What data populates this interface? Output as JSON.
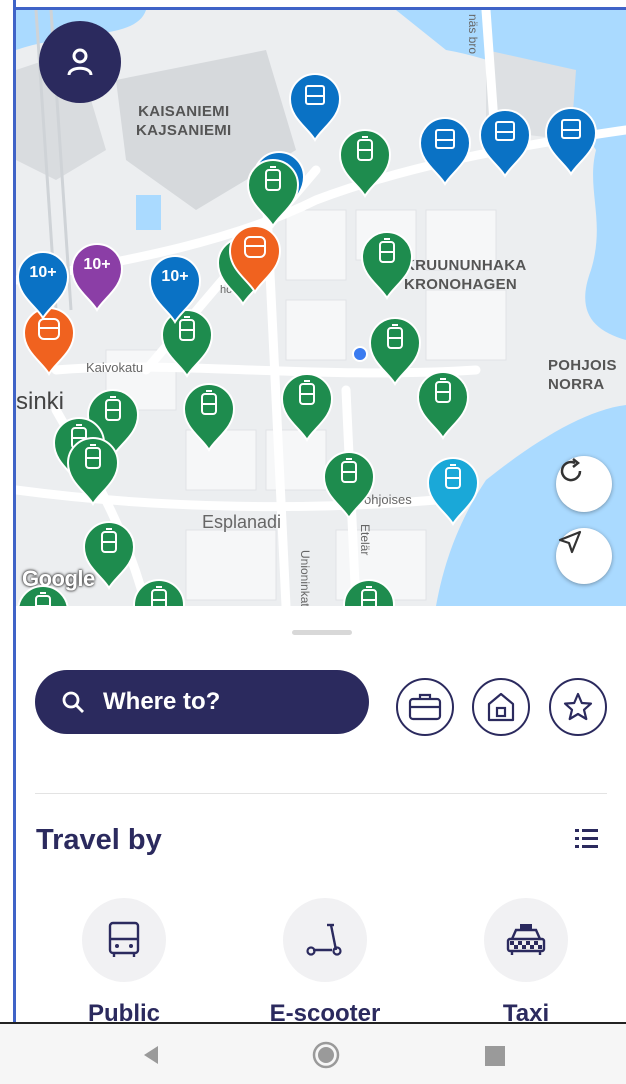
{
  "map": {
    "areas": [
      {
        "line1": "KAISANIEMI",
        "line2": "KAJSANIEMI"
      },
      {
        "line1": "KRUUNUNHAKA",
        "line2": "KRONOHAGEN"
      },
      {
        "line1": "POHJOIS",
        "line2": "NORRA"
      }
    ],
    "streets": {
      "kaivokatu": "Kaivokatu",
      "helsinki": "sinki",
      "esplanadi": "Esplanadi",
      "unioninkatu": "Unioninkatu",
      "etelar": "Etelär",
      "pohjoises": "ohjoises",
      "hon": "hon",
      "bro": "näs bro",
      "norra": "Norra"
    },
    "provider_logo": "Google",
    "cluster_labels": [
      "10+",
      "10+",
      "10+"
    ],
    "colors": {
      "tram": "#1e8c4e",
      "bus": "#0a72c5",
      "metro": "#f0621f",
      "train": "#8b3ea6",
      "ferry": "#1aa8d8",
      "water": "#aadaff"
    }
  },
  "buttons": {
    "avatar": "person-icon",
    "refresh": "refresh-icon",
    "locate": "locate-icon"
  },
  "sheet": {
    "search_label": "Where to?",
    "favorites": [
      "work-icon",
      "home-icon",
      "star-icon"
    ],
    "travel_title": "Travel by",
    "modes": [
      {
        "label": "Public",
        "icon": "bus-icon"
      },
      {
        "label": "E-scooter",
        "icon": "scooter-icon"
      },
      {
        "label": "Taxi",
        "icon": "taxi-icon"
      }
    ]
  },
  "theme": {
    "primary": "#2b2a5e"
  }
}
